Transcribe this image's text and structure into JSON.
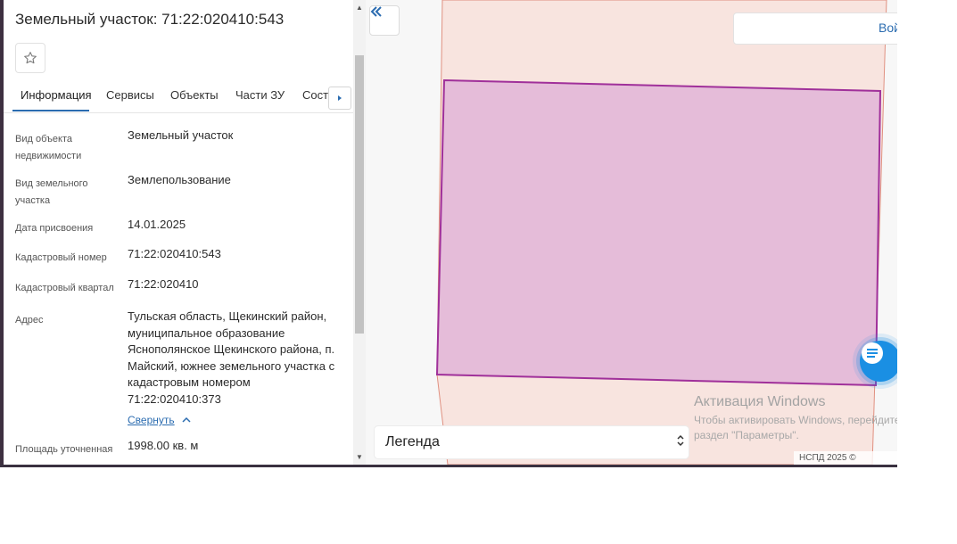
{
  "sidebar": {
    "title": "Земельный участок: 71:22:020410:543",
    "tabs": [
      {
        "label": "Информация"
      },
      {
        "label": "Сервисы"
      },
      {
        "label": "Объекты"
      },
      {
        "label": "Части ЗУ"
      },
      {
        "label": "Соста"
      }
    ],
    "fields": [
      {
        "label": "Вид объекта недвижимости",
        "value": "Земельный участок"
      },
      {
        "label": "Вид земельного участка",
        "value": "Землепользование"
      },
      {
        "label": "Дата присвоения",
        "value": "14.01.2025"
      },
      {
        "label": "Кадастровый номер",
        "value": "71:22:020410:543"
      },
      {
        "label": "Кадастровый квартал",
        "value": "71:22:020410"
      },
      {
        "label": "Адрес",
        "value": "Тульская область, Щекинский район, муниципальное образование Яснополянское Щекинского района, п. Майский, южнее земельного участка с кадастровым номером 71:22:020410:373"
      },
      {
        "label": "Площадь уточненная",
        "value": "1998.00 кв. м"
      }
    ],
    "collapse_link": "Свернуть"
  },
  "map": {
    "login_label": "Вой",
    "legend_label": "Легенда",
    "activation_title": "Активация Windows",
    "activation_line1": "Чтобы активировать Windows, перейдите в",
    "activation_line2": "раздел \"Параметры\".",
    "copyright": "НСПД 2025 ©",
    "colors": {
      "parcel_fill": "#e5bcd9",
      "parcel_stroke": "#a0309a",
      "zone_fill": "#f8e4df",
      "zone_stroke": "#e09080",
      "accent": "#2b6cb0",
      "chat": "#1a8fe3"
    }
  }
}
